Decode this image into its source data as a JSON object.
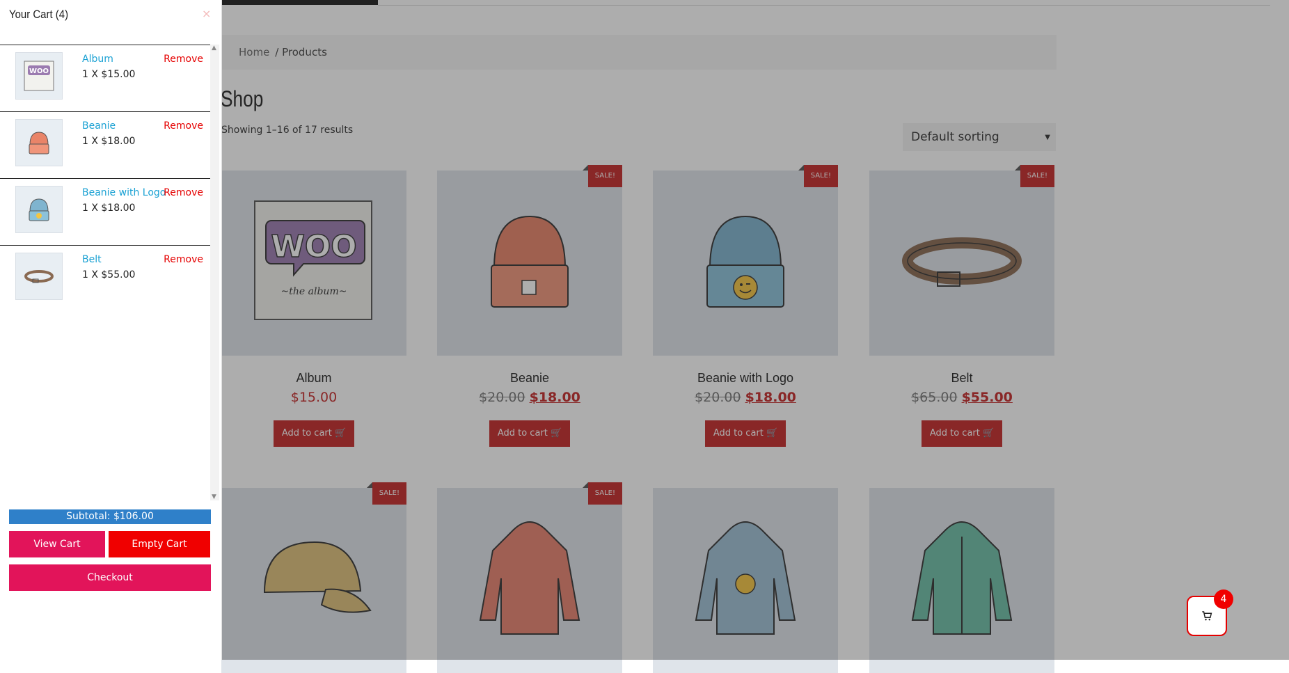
{
  "breadcrumb": {
    "home": "Home",
    "current": "/ Products"
  },
  "shop": {
    "title": "Shop",
    "showing": "Showing 1–16 of 17 results",
    "sorting": "Default sorting"
  },
  "products": [
    {
      "name": "Album",
      "old_price": "",
      "price": "$15.00",
      "sale": "",
      "button": "Add to cart"
    },
    {
      "name": "Beanie",
      "old_price": "$20.00",
      "price": "$18.00",
      "sale": "SALE!",
      "button": "Add to cart"
    },
    {
      "name": "Beanie with Logo",
      "old_price": "$20.00",
      "price": "$18.00",
      "sale": "SALE!",
      "button": "Add to cart"
    },
    {
      "name": "Belt",
      "old_price": "$65.00",
      "price": "$55.00",
      "sale": "SALE!",
      "button": "Add to cart"
    },
    {
      "name": "",
      "old_price": "",
      "price": "",
      "sale": "SALE!",
      "button": ""
    },
    {
      "name": "",
      "old_price": "",
      "price": "",
      "sale": "SALE!",
      "button": ""
    },
    {
      "name": "",
      "old_price": "",
      "price": "",
      "sale": "",
      "button": ""
    },
    {
      "name": "",
      "old_price": "",
      "price": "",
      "sale": "",
      "button": ""
    }
  ],
  "cart": {
    "title": "Your Cart (4)",
    "close": "×",
    "items": [
      {
        "name": "Album",
        "qty": "1 X $15.00",
        "remove": "Remove"
      },
      {
        "name": "Beanie",
        "qty": "1 X $18.00",
        "remove": "Remove"
      },
      {
        "name": "Beanie with Logo",
        "qty": "1 X $18.00",
        "remove": "Remove"
      },
      {
        "name": "Belt",
        "qty": "1 X $55.00",
        "remove": "Remove"
      }
    ],
    "subtotal": "Subtotal: $106.00",
    "view_cart": "View Cart",
    "empty_cart": "Empty Cart",
    "checkout": "Checkout",
    "badge_count": "4"
  },
  "colors": {
    "accent_red": "#c62828",
    "cart_pink": "#e2145a",
    "cart_red": "#f00000",
    "link_blue": "#1aa1d3",
    "subtotal_blue": "#2f80c9"
  }
}
